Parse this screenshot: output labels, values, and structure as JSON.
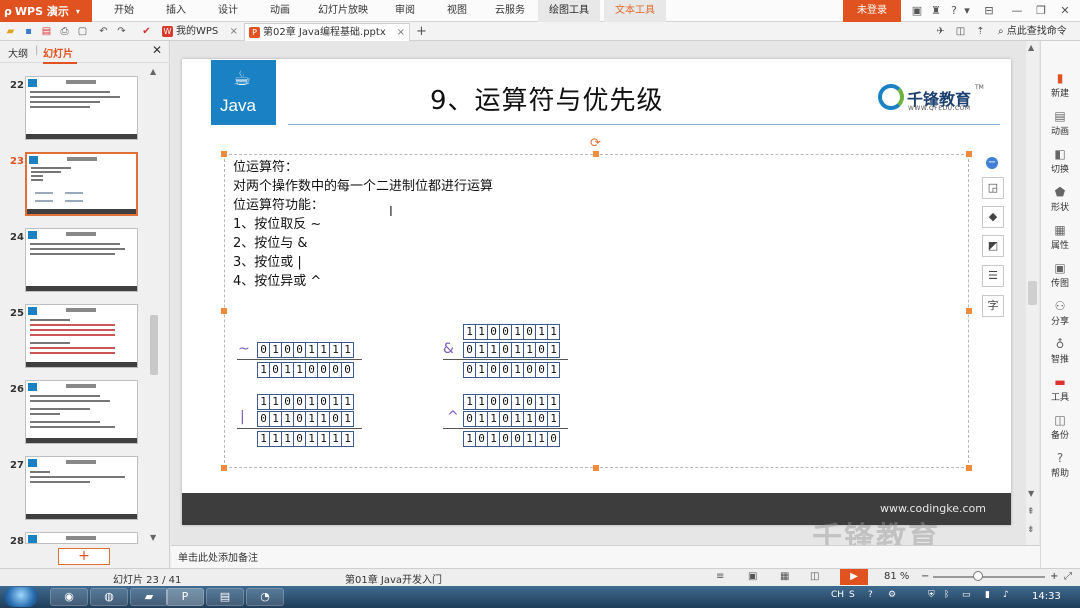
{
  "app": {
    "name": "WPS 演示",
    "login": "未登录"
  },
  "menu": [
    "开始",
    "插入",
    "设计",
    "动画",
    "幻灯片放映",
    "审阅",
    "视图",
    "云服务",
    "绘图工具",
    "文本工具"
  ],
  "tabs": [
    {
      "label": "我的WPS",
      "icon_color": "#d93a2b"
    },
    {
      "label": "第02章 Java编程基础.pptx",
      "icon_color": "#e0521f"
    }
  ],
  "search_help": "点此查找命令",
  "left_panel": {
    "tab_outline": "大纲",
    "tab_slides": "幻灯片",
    "thumbs": [
      {
        "num": "22"
      },
      {
        "num": "23",
        "selected": true
      },
      {
        "num": "24"
      },
      {
        "num": "25"
      },
      {
        "num": "26"
      },
      {
        "num": "27"
      },
      {
        "num": "28"
      }
    ],
    "add_button": "+"
  },
  "slide": {
    "logo_text": "Java",
    "title": "9、运算符与优先级",
    "brand_name": "千锋教育",
    "brand_url": "WWW.QFEDU.COM",
    "brand_tm": "TM",
    "lines": [
      "位运算符：",
      "对两个操作数中的每一个二进制位都进行运算",
      "位运算符功能：",
      "1、按位取反 ~",
      "2、按位与 &",
      "3、按位或 |",
      "4、按位异或 ^"
    ],
    "footer_url": "www.codingke.com",
    "watermark": "千锋教育"
  },
  "bit_tables": {
    "not": {
      "op": "~",
      "rows": [
        [
          "0",
          "1",
          "0",
          "0",
          "1",
          "1",
          "1",
          "1"
        ],
        [
          "1",
          "0",
          "1",
          "1",
          "0",
          "0",
          "0",
          "0"
        ]
      ]
    },
    "and": {
      "op": "&",
      "rows": [
        [
          "1",
          "1",
          "0",
          "0",
          "1",
          "0",
          "1",
          "1"
        ],
        [
          "0",
          "1",
          "1",
          "0",
          "1",
          "1",
          "0",
          "1"
        ],
        [
          "0",
          "1",
          "0",
          "0",
          "1",
          "0",
          "0",
          "1"
        ]
      ]
    },
    "or": {
      "op": "|",
      "rows": [
        [
          "1",
          "1",
          "0",
          "0",
          "1",
          "0",
          "1",
          "1"
        ],
        [
          "0",
          "1",
          "1",
          "0",
          "1",
          "1",
          "0",
          "1"
        ],
        [
          "1",
          "1",
          "1",
          "0",
          "1",
          "1",
          "1",
          "1"
        ]
      ]
    },
    "xor": {
      "op": "^",
      "rows": [
        [
          "1",
          "1",
          "0",
          "0",
          "1",
          "0",
          "1",
          "1"
        ],
        [
          "0",
          "1",
          "1",
          "0",
          "1",
          "1",
          "0",
          "1"
        ],
        [
          "1",
          "0",
          "1",
          "0",
          "0",
          "1",
          "1",
          "0"
        ]
      ]
    }
  },
  "right_panel": [
    "新建",
    "动画",
    "切换",
    "形状",
    "属性",
    "传图",
    "分享",
    "智推",
    "工具",
    "备份",
    "帮助"
  ],
  "notes_placeholder": "单击此处添加备注",
  "status": {
    "slide_counter": "幻灯片 23 / 41",
    "section": "第01章 Java开发入门",
    "zoom": "81 %",
    "minus": "−",
    "plus": "+"
  },
  "taskbar": {
    "clock": "14:33",
    "lang": "CH"
  }
}
